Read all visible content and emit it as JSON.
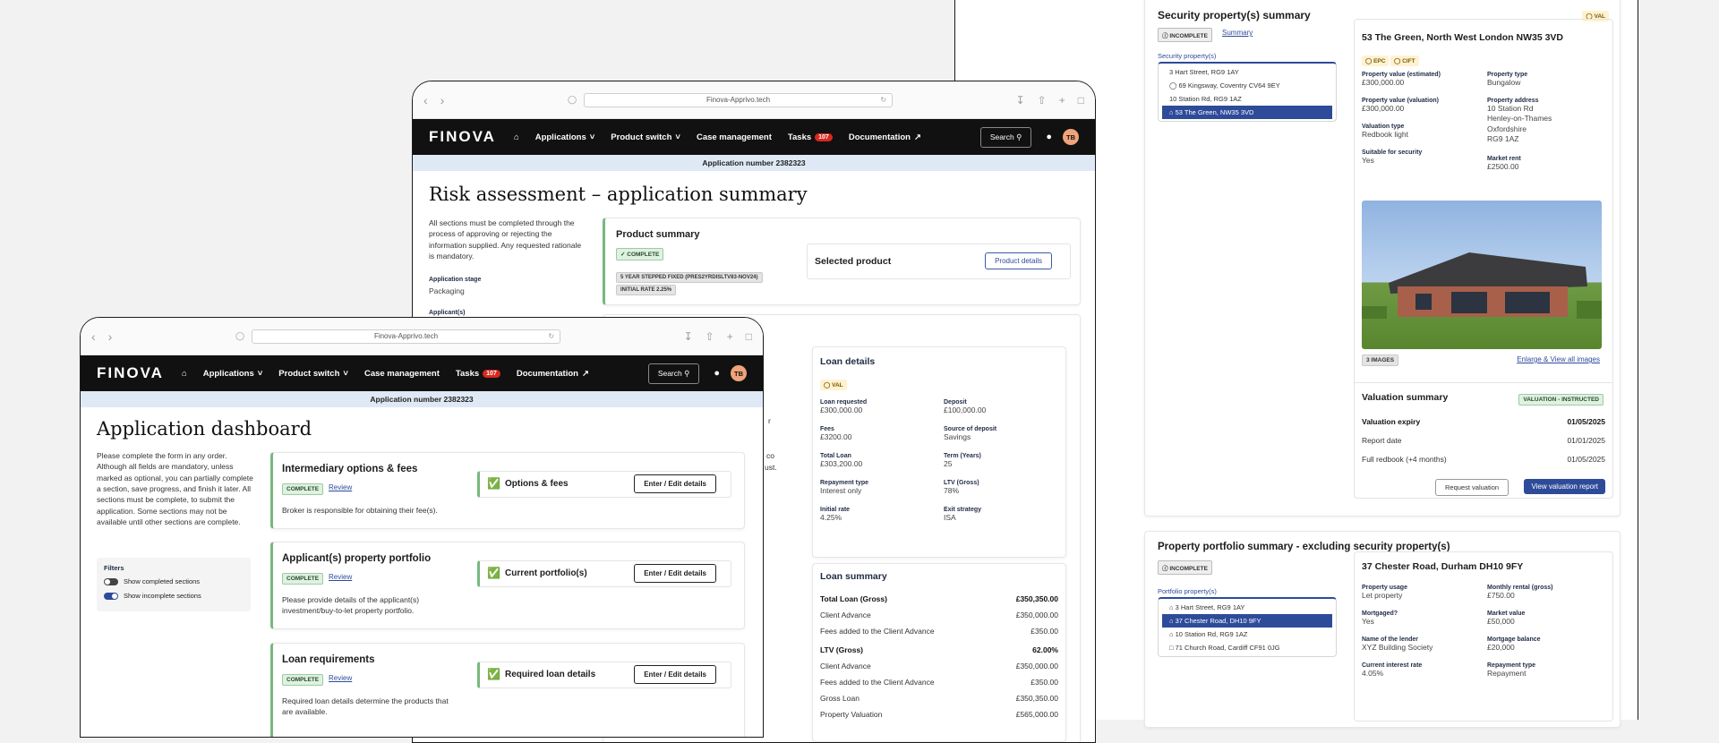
{
  "browser": {
    "url": "Finova-Apprivo.tech"
  },
  "nav": {
    "logo": "FINOVA",
    "applications": "Applications",
    "product_switch": "Product switch",
    "case_management": "Case management",
    "tasks": "Tasks",
    "tasks_count": "107",
    "documentation": "Documentation",
    "search": "Search",
    "avatar": "TB"
  },
  "app_number": "Application number 2382323",
  "risk": {
    "title": "Risk assessment – application summary",
    "intro": "All sections must be completed through the process of approving or rejecting the information supplied. Any requested rationale is mandatory.",
    "stage_label": "Application stage",
    "stage_value": "Packaging",
    "applicants_label": "Applicant(s)",
    "product_summary": "Product summary",
    "complete": "COMPLETE",
    "product_tag1": "5 YEAR STEPPED FIXED (PRES2YRDISLTV83-NOV24)",
    "product_tag2": "INITIAL RATE 2.25%",
    "selected_product": "Selected product",
    "product_details": "Product details",
    "stray_text1": "r",
    "stray_text2": "co",
    "stray_text3": "ust.",
    "loan_details": {
      "title": "Loan details",
      "val_tag": "VAL",
      "items": [
        {
          "label": "Loan requested",
          "value": "£300,000.00"
        },
        {
          "label": "Deposit",
          "value": "£100,000.00"
        },
        {
          "label": "Fees",
          "value": "£3200.00"
        },
        {
          "label": "Source of deposit",
          "value": "Savings"
        },
        {
          "label": "Total Loan",
          "value": "£303,200.00"
        },
        {
          "label": "Term (Years)",
          "value": "25"
        },
        {
          "label": "Repayment type",
          "value": "Interest only"
        },
        {
          "label": "LTV (Gross)",
          "value": "78%"
        },
        {
          "label": "Initial rate",
          "value": "4.25%"
        },
        {
          "label": "Exit strategy",
          "value": "ISA"
        }
      ]
    },
    "loan_summary": {
      "title": "Loan summary",
      "rows": [
        {
          "label": "Total Loan (Gross)",
          "value": "£350,350.00",
          "bold": true
        },
        {
          "label": "Client Advance",
          "value": "£350,000.00"
        },
        {
          "label": "Fees added to the Client Advance",
          "value": "£350.00"
        },
        {
          "label": "LTV (Gross)",
          "value": "62.00%",
          "bold": true
        },
        {
          "label": "Client Advance",
          "value": "£350,000.00"
        },
        {
          "label": "Fees added to the Client Advance",
          "value": "£350.00"
        },
        {
          "label": "Gross Loan",
          "value": "£350,350.00"
        },
        {
          "label": "Property Valuation",
          "value": "£565,000.00"
        }
      ]
    }
  },
  "dashboard": {
    "title": "Application dashboard",
    "intro": "Please complete the form in any order. Although all fields are mandatory, unless marked as optional, you can partially complete a section, save progress, and finish it later. All sections must be complete, to submit the application. Some sections may not be available until other sections are complete.",
    "filters": "Filters",
    "filter1": "Show completed sections",
    "filter2": "Show incomplete sections",
    "review": "Review",
    "enter_edit": "Enter / Edit details",
    "sections": [
      {
        "title": "Intermediary options & fees",
        "status": "COMPLETE",
        "sub": "Options & fees",
        "desc": "Broker is responsible for obtaining their fee(s)."
      },
      {
        "title": "Applicant(s) property portfolio",
        "status": "COMPLETE",
        "sub": "Current portfolio(s)",
        "desc": "Please provide details of the applicant(s) investment/buy-to-let property portfolio."
      },
      {
        "title": "Loan requirements",
        "status": "COMPLETE",
        "sub": "Required loan details",
        "desc": "Required loan details determine the products that are available."
      }
    ]
  },
  "security": {
    "title": "Security property(s) summary",
    "val_tag": "VAL",
    "incomplete": "INCOMPLETE",
    "summary_tab": "Summary",
    "list_label": "Security property(s)",
    "list": [
      "3 Hart Street, RG9 1AY",
      "69 Kingsway, Coventry CV64 9EY",
      "10 Station Rd, RG9 1AZ",
      "53 The Green, NW35 3VD"
    ],
    "detail_title": "53 The Green, North West London  NW35 3VD",
    "epc": "EPC",
    "cift": "CIFT",
    "fields_left": [
      {
        "label": "Property value (estimated)",
        "value": "£300,000.00"
      },
      {
        "label": "Property value (valuation)",
        "value": "£300,000.00"
      },
      {
        "label": "Valuation type",
        "value": "Redbook light"
      },
      {
        "label": "Suitable for security",
        "value": "Yes"
      }
    ],
    "fields_right": [
      {
        "label": "Property type",
        "value": "Bungalow"
      },
      {
        "label": "Property address",
        "value": "10 Station Rd\nHenley-on-Thames\nOxfordshire\nRG9 1AZ"
      },
      {
        "label": "Market rent",
        "value": "£2500.00"
      }
    ],
    "images_tag": "3 IMAGES",
    "enlarge": "Enlarge & View all images",
    "valuation": {
      "title": "Valuation summary",
      "status": "VALUATION - INSTRUCTED",
      "rows": [
        {
          "label": "Valuation expiry",
          "value": "01/05/2025",
          "bold": true
        },
        {
          "label": "Report date",
          "value": "01/01/2025"
        },
        {
          "label": "Full redbook (+4 months)",
          "value": "01/05/2025"
        }
      ],
      "request": "Request valuation",
      "view": "View valuation report"
    }
  },
  "portfolio": {
    "title": "Property portfolio summary - excluding security property(s)",
    "incomplete": "INCOMPLETE",
    "list_label": "Portfolio property(s)",
    "list": [
      "3 Hart Street, RG9 1AY",
      "37 Chester Road, DH10 9FY",
      "10 Station Rd, RG9 1AZ",
      "71 Church Road, Cardiff  CF91 0JG"
    ],
    "detail_title": "37 Chester Road, Durham  DH10 9FY",
    "fields": [
      {
        "label": "Property usage",
        "value": "Let property"
      },
      {
        "label": "Monthly rental (gross)",
        "value": "£750.00"
      },
      {
        "label": "Mortgaged?",
        "value": "Yes"
      },
      {
        "label": "Market value",
        "value": "£50,000"
      },
      {
        "label": "Name of the lender",
        "value": "XYZ Building Society"
      },
      {
        "label": "Mortgage balance",
        "value": "£20,000"
      },
      {
        "label": "Current interest rate",
        "value": "4.05%"
      },
      {
        "label": "Repayment type",
        "value": "Repayment"
      }
    ]
  }
}
